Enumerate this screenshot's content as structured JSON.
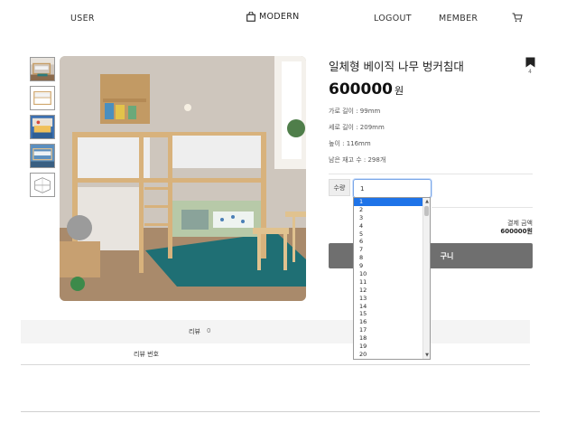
{
  "header": {
    "user": "USER",
    "brand": "MODERN",
    "logout": "LOGOUT",
    "member": "MEMBER",
    "icons": {
      "brand": "shopping-bag-icon",
      "cart": "cart-icon"
    }
  },
  "gallery": {
    "thumbnails": [
      "bunk-bed-room-photo",
      "bunk-bed-cutout-photo",
      "bunk-bed-kids-photo",
      "bunk-bed-blue-room-photo",
      "bunk-bed-line-drawing"
    ],
    "main_image": "bunk-bed-room-photo"
  },
  "product": {
    "title": "일체형 베이직 나무 벙커침대",
    "bookmark_count": "4",
    "price": "600000",
    "price_unit": "원",
    "specs": [
      "가로 길이 : 99mm",
      "세로 길이 : 209mm",
      "높이 : 116mm",
      "남은 재고 수 : 298개"
    ]
  },
  "purchase": {
    "qty_label": "수량",
    "qty_value": "1",
    "total_label": "결제 금액",
    "total_value": "600000원",
    "cart_button": "구니"
  },
  "dropdown": {
    "options": [
      "1",
      "2",
      "3",
      "4",
      "5",
      "6",
      "7",
      "8",
      "9",
      "10",
      "11",
      "12",
      "13",
      "14",
      "15",
      "16",
      "17",
      "18",
      "19",
      "20"
    ],
    "selected_index": 0
  },
  "reviews": {
    "title": "리뷰",
    "count": "0",
    "column": "리뷰 번호"
  },
  "colors": {
    "accent": "#1e73e8",
    "button": "#6f6f6f"
  }
}
